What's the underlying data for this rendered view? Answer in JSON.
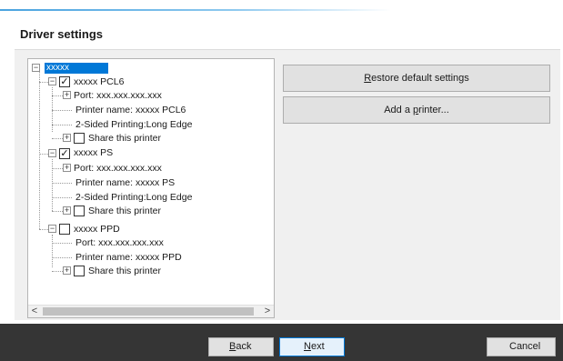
{
  "dialog": {
    "title": "Driver settings"
  },
  "tree": {
    "root": "xxxxx",
    "printers": [
      {
        "name": "xxxxx PCL6",
        "checked": true,
        "port": "Port: xxx.xxx.xxx.xxx",
        "printer_name": "Printer name: xxxxx PCL6",
        "duplex": "2-Sided Printing:Long Edge",
        "share": "Share this printer"
      },
      {
        "name": "xxxxx PS",
        "checked": true,
        "port": "Port: xxx.xxx.xxx.xxx",
        "printer_name": "Printer name:  xxxxx PS",
        "duplex": "2-Sided Printing:Long Edge",
        "share": "Share this printer"
      },
      {
        "name": "xxxxx PPD",
        "checked": false,
        "port": "Port: xxx.xxx.xxx.xxx",
        "printer_name": "Printer name: xxxxx PPD",
        "share": "Share this printer"
      }
    ]
  },
  "actions": {
    "restore_pre": "",
    "restore_u": "R",
    "restore_post": "estore default settings",
    "add_pre": "Add a ",
    "add_u": "p",
    "add_post": "rinter..."
  },
  "footer": {
    "back_u": "B",
    "back_post": "ack",
    "next_u": "N",
    "next_post": "ext",
    "cancel": "Cancel"
  },
  "icons": {
    "expand": "plus-box",
    "collapse": "minus-box",
    "check": "checkmark",
    "scroll_left": "chevron-left",
    "scroll_right": "chevron-right"
  }
}
